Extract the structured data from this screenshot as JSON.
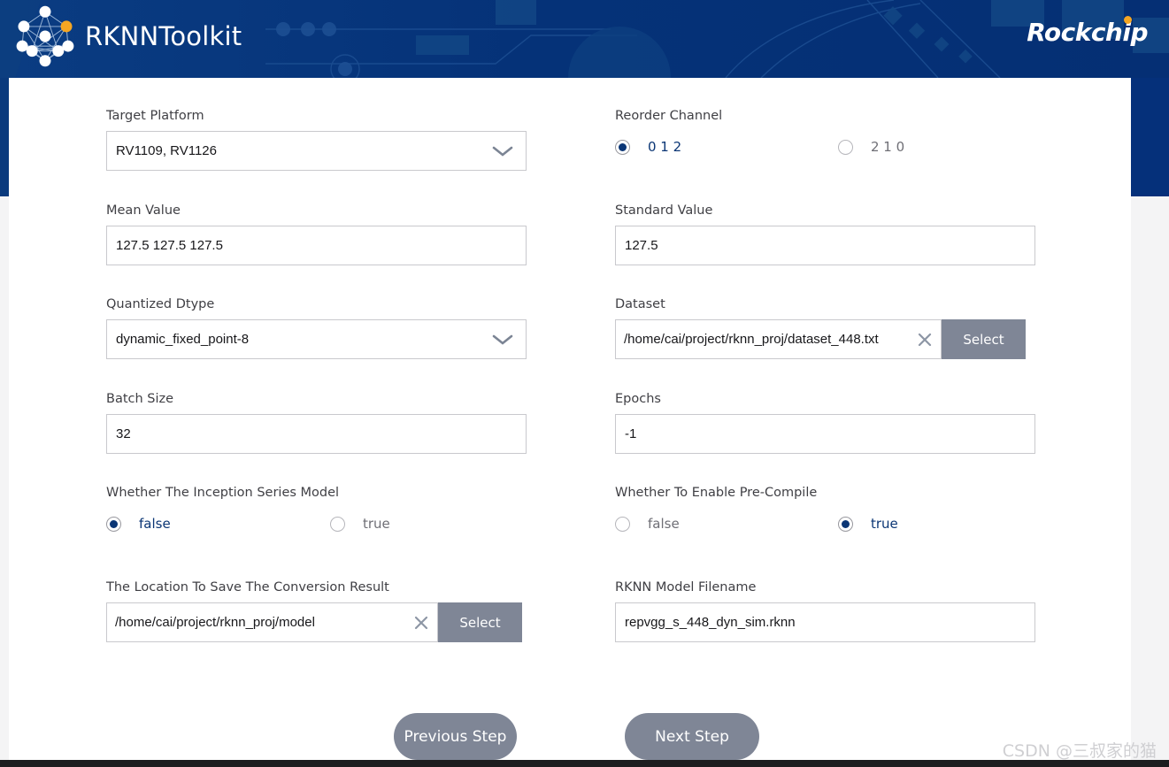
{
  "header": {
    "app_title": "RKNNToolkit",
    "brand_logo_icon": "network-graph-icon",
    "vendor_logo_text": "Rockchip"
  },
  "form": {
    "target_platform": {
      "label": "Target Platform",
      "value": "RV1109, RV1126",
      "icon": "chevron-down-icon"
    },
    "reorder_channel": {
      "label": "Reorder Channel",
      "options": [
        {
          "label": "0 1 2",
          "selected": true
        },
        {
          "label": "2 1 0",
          "selected": false
        }
      ]
    },
    "mean_value": {
      "label": "Mean Value",
      "value": "127.5 127.5 127.5"
    },
    "standard_value": {
      "label": "Standard Value",
      "value": "127.5"
    },
    "quantized_dtype": {
      "label": "Quantized Dtype",
      "value": "dynamic_fixed_point-8",
      "icon": "chevron-down-icon"
    },
    "dataset": {
      "label": "Dataset",
      "value": "/home/cai/project/rknn_proj/dataset_448.txt",
      "clear_icon": "close-x-icon",
      "button_label": "Select"
    },
    "batch_size": {
      "label": "Batch Size",
      "value": "32"
    },
    "epochs": {
      "label": "Epochs",
      "value": "-1"
    },
    "inception_series": {
      "label": "Whether The Inception Series Model",
      "options": [
        {
          "label": "false",
          "selected": true
        },
        {
          "label": "true",
          "selected": false
        }
      ]
    },
    "pre_compile": {
      "label": "Whether To Enable Pre-Compile",
      "options": [
        {
          "label": "false",
          "selected": false
        },
        {
          "label": "true",
          "selected": true
        }
      ]
    },
    "save_location": {
      "label": "The Location To Save The Conversion Result",
      "value": "/home/cai/project/rknn_proj/model",
      "clear_icon": "close-x-icon",
      "button_label": "Select"
    },
    "rknn_model_filename": {
      "label": "RKNN Model Filename",
      "value": "repvgg_s_448_dyn_sim.rknn"
    }
  },
  "footer": {
    "previous_label": "Previous Step",
    "next_label": "Next Step"
  },
  "watermark": {
    "text": "CSDN @三叔家的猫"
  },
  "colors": {
    "header_blue": "#053278",
    "accent_orange": "#f5a623",
    "button_slate": "#7f8696",
    "selected_blue": "#0b3675",
    "page_grey": "#f4f4f5"
  }
}
